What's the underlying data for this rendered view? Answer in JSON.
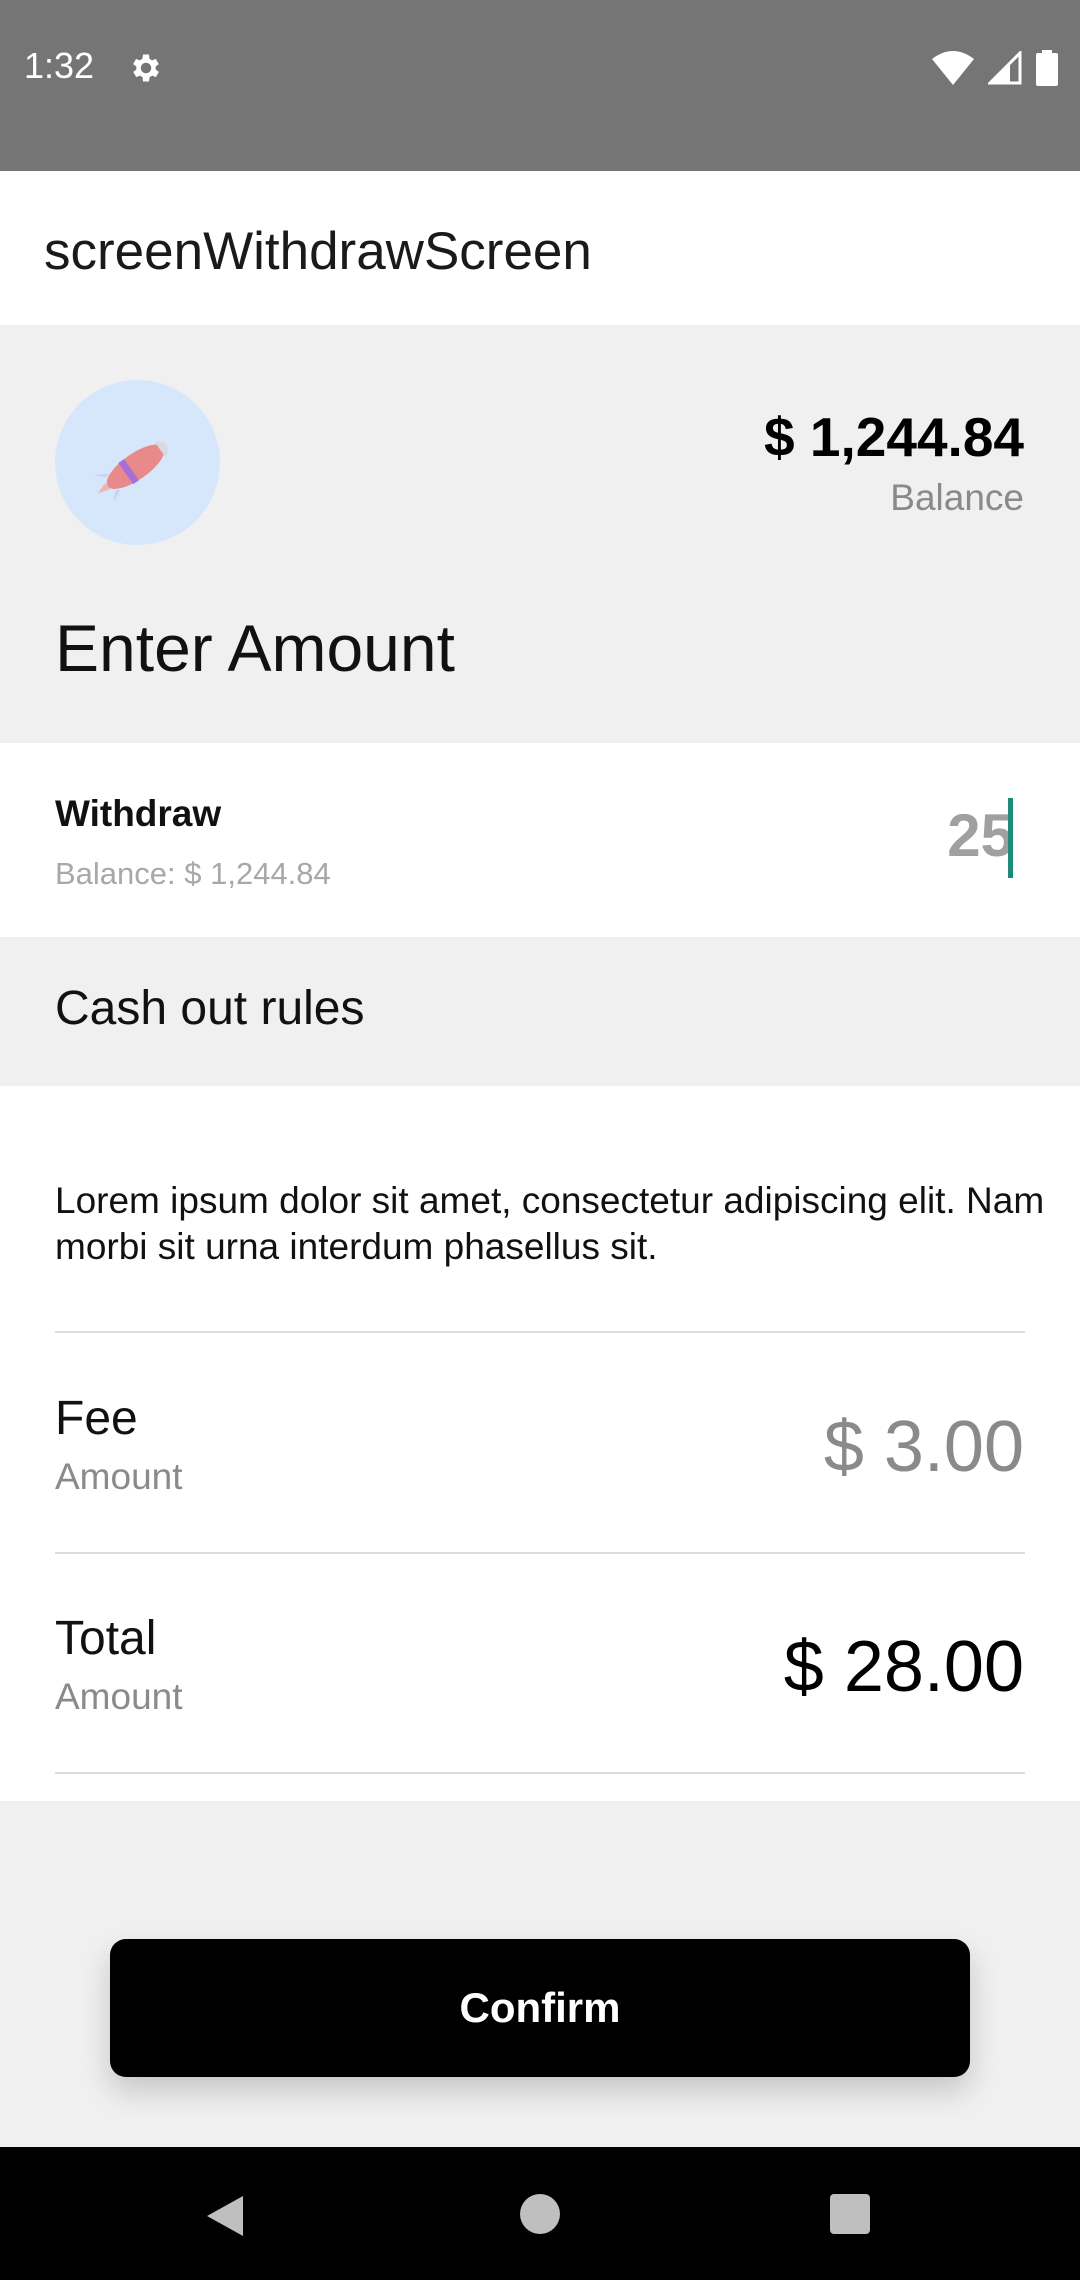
{
  "status_bar": {
    "time": "1:32"
  },
  "app_bar": {
    "title": "screenWithdrawScreen"
  },
  "header": {
    "balance_amount": "$ 1,244.84",
    "balance_label": "Balance",
    "enter_amount_title": "Enter Amount"
  },
  "withdraw": {
    "title": "Withdraw",
    "balance_text": "Balance: $ 1,244.84",
    "input_value": "25"
  },
  "rules": {
    "title": "Cash out rules",
    "text": "Lorem ipsum dolor sit amet, consectetur adipiscing elit. Nam morbi sit urna interdum phasellus sit.",
    "fee": {
      "label": "Fee",
      "sub": "Amount",
      "value": "$ 3.00"
    },
    "total": {
      "label": "Total",
      "sub": "Amount",
      "value": "$ 28.00"
    }
  },
  "confirm_label": "Confirm",
  "colors": {
    "caret": "#1e8a78",
    "avatar_bg": "#d6e6fb",
    "button_bg": "#000000"
  },
  "icons": [
    "gear-icon",
    "wifi-icon",
    "signal-icon",
    "battery-icon",
    "rocket-icon",
    "back-icon",
    "home-icon",
    "recents-icon"
  ]
}
